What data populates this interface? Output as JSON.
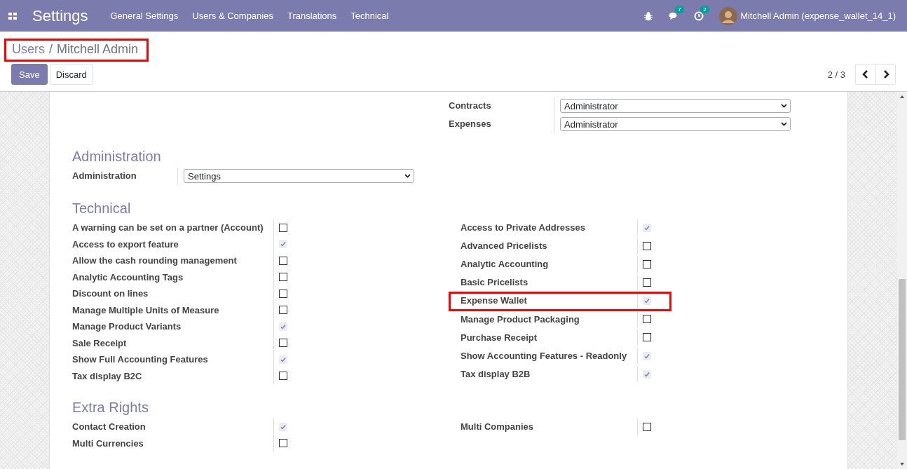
{
  "navbar": {
    "app_title": "Settings",
    "menu": [
      "General Settings",
      "Users & Companies",
      "Translations",
      "Technical"
    ],
    "messages_badge": "7",
    "activities_badge": "2",
    "user": "Mitchell Admin (expense_wallet_14_1)"
  },
  "breadcrumb": {
    "items": [
      "Users",
      "Mitchell Admin"
    ],
    "separator": "/",
    "highlighted": true
  },
  "buttons": [
    {
      "label": "Save",
      "kind": "primary"
    },
    {
      "label": "Discard",
      "kind": "secondary"
    }
  ],
  "pager": "2 / 3",
  "sections": [
    {
      "kind": "selects",
      "fields": [
        {
          "label": "Contracts",
          "value": "Administrator"
        },
        {
          "label": "Expenses",
          "value": "Administrator"
        }
      ]
    },
    {
      "kind": "selects",
      "title": "Administration",
      "fields": [
        {
          "label": "Administration",
          "value": "Settings"
        }
      ]
    },
    {
      "kind": "checkboxes",
      "title": "Technical",
      "columns": [
        [
          {
            "label": "A warning can be set on a partner (Account)",
            "checked": false,
            "highlighted": false
          },
          {
            "label": "Access to export feature",
            "checked": true,
            "highlighted": false
          },
          {
            "label": "Allow the cash rounding management",
            "checked": false,
            "highlighted": false
          },
          {
            "label": "Analytic Accounting Tags",
            "checked": false,
            "highlighted": false
          },
          {
            "label": "Discount on lines",
            "checked": false,
            "highlighted": false
          },
          {
            "label": "Manage Multiple Units of Measure",
            "checked": false,
            "highlighted": false
          },
          {
            "label": "Manage Product Variants",
            "checked": true,
            "highlighted": false
          },
          {
            "label": "Sale Receipt",
            "checked": false,
            "highlighted": false
          },
          {
            "label": "Show Full Accounting Features",
            "checked": true,
            "highlighted": false
          },
          {
            "label": "Tax display B2C",
            "checked": false,
            "highlighted": false
          }
        ],
        [
          {
            "label": "Access to Private Addresses",
            "checked": true,
            "highlighted": false
          },
          {
            "label": "Advanced Pricelists",
            "checked": false,
            "highlighted": false
          },
          {
            "label": "Analytic Accounting",
            "checked": false,
            "highlighted": false
          },
          {
            "label": "Basic Pricelists",
            "checked": false,
            "highlighted": false
          },
          {
            "label": "Expense Wallet",
            "checked": true,
            "highlighted": true
          },
          {
            "label": "Manage Product Packaging",
            "checked": false,
            "highlighted": false
          },
          {
            "label": "Purchase Receipt",
            "checked": false,
            "highlighted": false
          },
          {
            "label": "Show Accounting Features - Readonly",
            "checked": true,
            "highlighted": false
          },
          {
            "label": "Tax display B2B",
            "checked": true,
            "highlighted": false
          }
        ]
      ]
    },
    {
      "kind": "checkboxes",
      "title": "Extra Rights",
      "columns": [
        [
          {
            "label": "Contact Creation",
            "checked": true,
            "highlighted": false
          },
          {
            "label": "Multi Currencies",
            "checked": false,
            "highlighted": false
          }
        ],
        [
          {
            "label": "Multi Companies",
            "checked": false,
            "highlighted": false
          }
        ]
      ]
    }
  ]
}
